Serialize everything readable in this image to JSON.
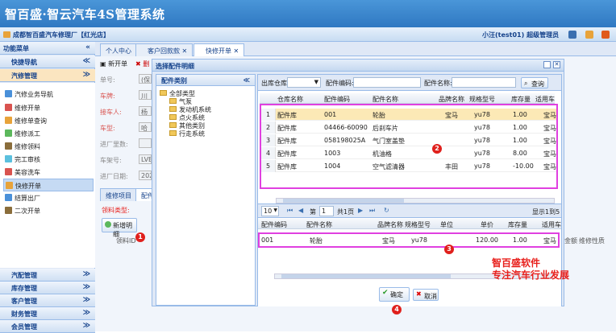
{
  "app": {
    "title": "智百盛·智云汽车4S管理系统"
  },
  "subbar": {
    "store": "成都智百盛汽车修理厂【红光店】",
    "user": "小汪(test01)  超级管理员"
  },
  "sidebar": {
    "menu_title": "功能菜单",
    "top_sections": [
      {
        "label": "快捷导航"
      },
      {
        "label": "汽修管理"
      }
    ],
    "items": [
      {
        "label": "汽修业务导航",
        "color": "#4a90d9"
      },
      {
        "label": "维修开单",
        "color": "#d9534f"
      },
      {
        "label": "维修单查询",
        "color": "#e8a33a"
      },
      {
        "label": "维修派工",
        "color": "#5cb85c"
      },
      {
        "label": "维修领料",
        "color": "#8a6d3b"
      },
      {
        "label": "完工审核",
        "color": "#5bc0de"
      },
      {
        "label": "美容洗车",
        "color": "#d9534f"
      },
      {
        "label": "快修开单",
        "color": "#e8a33a"
      },
      {
        "label": "结算出厂",
        "color": "#4a90d9"
      },
      {
        "label": "二次开单",
        "color": "#8a6d3b"
      }
    ],
    "bottom_sections": [
      {
        "label": "汽配管理"
      },
      {
        "label": "库存管理"
      },
      {
        "label": "客户管理"
      },
      {
        "label": "财务管理"
      },
      {
        "label": "会员管理"
      }
    ]
  },
  "tabs": [
    {
      "label": "个人中心"
    },
    {
      "label": "客户回款款"
    },
    {
      "label": "快修开单"
    }
  ],
  "bgform": {
    "toolbar_new": "新开单",
    "toolbar_del": "删",
    "fields": [
      {
        "label": "单号:",
        "value": "(保"
      },
      {
        "label": "车牌:",
        "value": "川A"
      },
      {
        "label": "接车人:",
        "value": "杨涛"
      },
      {
        "label": "车型:",
        "value": "哈弗"
      },
      {
        "label": "进厂里数:",
        "value": ""
      },
      {
        "label": "车架号:",
        "value": "LVB"
      },
      {
        "label": "进厂日期:",
        "value": "202"
      }
    ],
    "subtab1": "维修项目",
    "subtab2": "配件",
    "parts_type_label": "领料类型:",
    "add_detail": "新增明细",
    "col_part_id": "领料ID",
    "col_repair_prop": "维修性质",
    "col_nshu": "金额"
  },
  "dialog": {
    "title": "选择配件明细",
    "tree_title": "配件类别",
    "tree_root": "全部类型",
    "tree_nodes": [
      "气泵",
      "发动机系统",
      "点火系统",
      "其他类别",
      "行走系统"
    ],
    "filter": {
      "warehouse_label": "出库仓库:",
      "code_label": "配件编码:",
      "name_label": "配件名称:",
      "search": "查询"
    },
    "columns": [
      "仓库名称",
      "配件编码",
      "配件名称",
      "品牌名称",
      "规格型号",
      "库存量",
      "适用车"
    ],
    "rows": [
      {
        "n": "1",
        "wh": "配件库",
        "code": "001",
        "name": "轮胎",
        "brand": "宝马",
        "spec": "yu78",
        "stock": "1.00",
        "car": "宝马"
      },
      {
        "n": "2",
        "wh": "配件库",
        "code": "04466-60090",
        "name": "后刹车片",
        "brand": "",
        "spec": "yu78",
        "stock": "1.00",
        "car": "宝马"
      },
      {
        "n": "3",
        "wh": "配件库",
        "code": "058198025A",
        "name": "气门室盖垫",
        "brand": "",
        "spec": "yu78",
        "stock": "1.00",
        "car": "宝马"
      },
      {
        "n": "4",
        "wh": "配件库",
        "code": "1003",
        "name": "机油格",
        "brand": "",
        "spec": "yu78",
        "stock": "8.00",
        "car": "宝马"
      },
      {
        "n": "5",
        "wh": "配件库",
        "code": "1004",
        "name": "空气滤清器",
        "brand": "丰田",
        "spec": "yu78",
        "stock": "-10.00",
        "car": "宝马"
      }
    ],
    "pager": {
      "page_size": "10",
      "page_label": "第",
      "page": "1",
      "total_label": "共1页",
      "display": "显示1到5"
    },
    "sel_columns": [
      "配件编码",
      "配件名称",
      "品牌名称",
      "规格型号",
      "单位",
      "单价",
      "库存量",
      "适用车"
    ],
    "sel_row": {
      "code": "001",
      "name": "轮胎",
      "brand": "宝马",
      "spec": "yu78",
      "unit": "",
      "price": "120.00",
      "stock": "1.00",
      "car": "宝马"
    },
    "confirm": "确定",
    "cancel": "取消"
  },
  "brand": {
    "line1": "智百盛软件",
    "line2": "专注汽车行业发展"
  },
  "badges": [
    "1",
    "2",
    "3",
    "4"
  ]
}
